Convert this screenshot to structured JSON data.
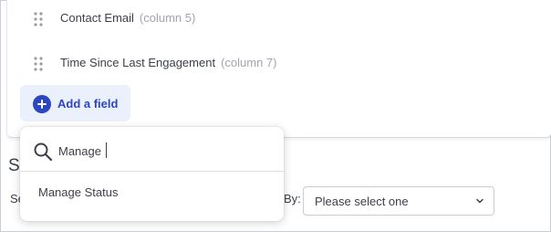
{
  "fields": [
    {
      "name": "Contact Email",
      "column": "(column 5)"
    },
    {
      "name": "Time Since Last Engagement",
      "column": "(column 7)"
    }
  ],
  "add_field": {
    "label": "Add a field",
    "icon": "plus-circle-icon"
  },
  "background": {
    "section_title_fragment": "S",
    "label_fragment": "Se",
    "by_label": "By:",
    "select_value": "Please select one"
  },
  "search_popover": {
    "query": "Manage",
    "results": [
      {
        "label": "Manage Status"
      }
    ]
  },
  "colors": {
    "accent": "#2c46c2",
    "accent_bg": "#eaf0fc",
    "text": "#3d3f4a",
    "muted": "#a2a5ad",
    "border": "#c9cdd4"
  }
}
